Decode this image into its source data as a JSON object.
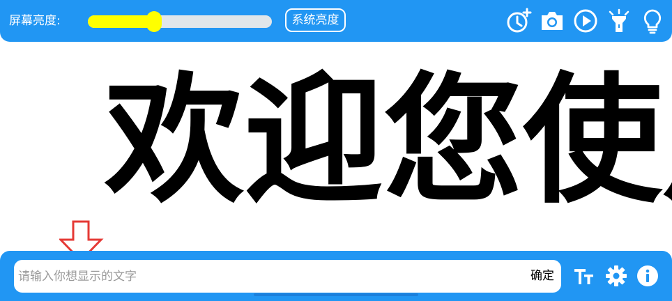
{
  "top_bar": {
    "brightness_label": "屏幕亮度:",
    "brightness_level": 0.36,
    "system_brightness_label": "系统亮度",
    "icons": [
      "timer-add-icon",
      "camera-icon",
      "play-icon",
      "flashlight-icon",
      "lightbulb-icon"
    ]
  },
  "display": {
    "text": "欢迎您使用"
  },
  "bottom_bar": {
    "input_placeholder": "请输入你想显示的文字",
    "input_value": "",
    "confirm_label": "确定",
    "icons": [
      "text-size-icon",
      "settings-icon",
      "info-icon"
    ]
  },
  "colors": {
    "bar_blue": "#2196f3",
    "slider_fill": "#ffff00",
    "arrow_red": "#e53935",
    "display_text": "#000000"
  }
}
